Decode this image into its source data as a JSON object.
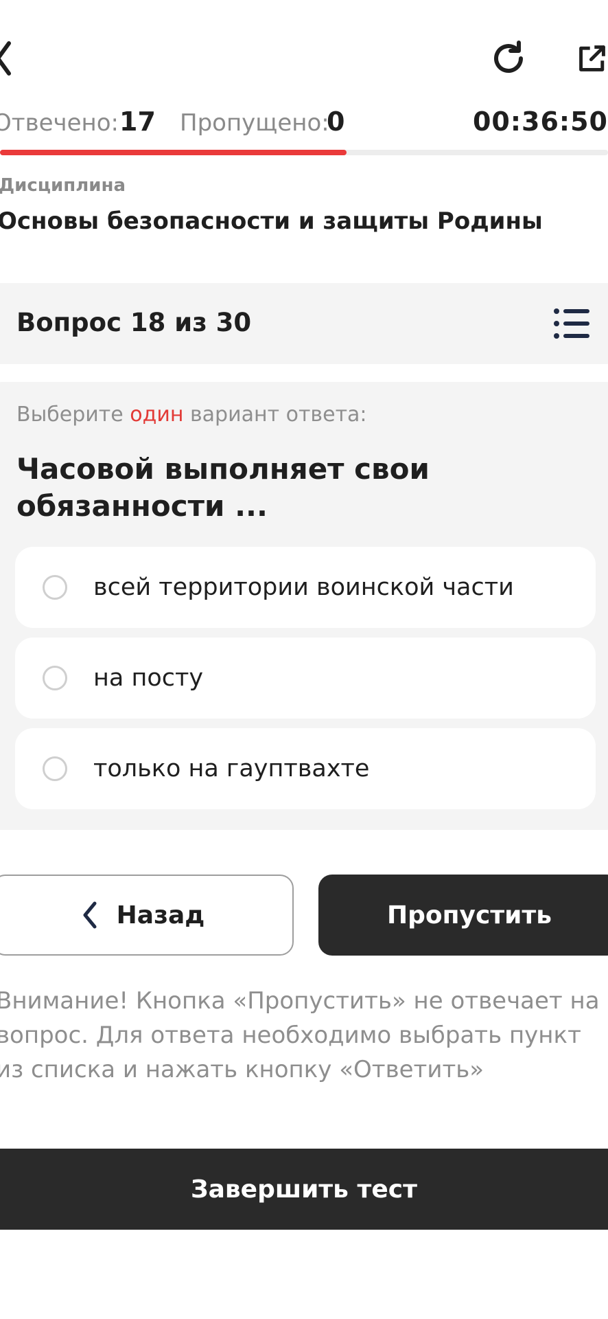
{
  "topbar": {
    "back_icon": "chevron-left-icon",
    "refresh_icon": "refresh-icon",
    "share_icon": "external-link-icon"
  },
  "stats": {
    "answered_label": "Отвечено:",
    "answered_value": "17",
    "skipped_label": "Пропущено:",
    "skipped_value": "0",
    "timer": "00:36:50",
    "progress_percent": 57
  },
  "discipline": {
    "label": "Дисциплина",
    "title": "Основы безопасности и защиты Родины"
  },
  "question_header": {
    "title": "Вопрос 18 из 30",
    "list_icon": "list-icon"
  },
  "question": {
    "hint_before": "Выберите ",
    "hint_accent": "один",
    "hint_after": " вариант ответа:",
    "text": "Часовой выполняет свои обязанности ...",
    "options": [
      "всей территории воинской части",
      "на посту",
      "только на гауптвахте"
    ]
  },
  "buttons": {
    "back": "Назад",
    "skip": "Пропустить",
    "finish": "Завершить тест"
  },
  "warning": "Внимание! Кнопка «Пропустить» не отвечает на вопрос. Для ответа необходимо выбрать пункт из списка и нажать кнопку «Ответить»",
  "colors": {
    "accent": "#ea3a3a",
    "dark_button": "#2a2a2a",
    "card_bg": "#f4f4f4",
    "muted_text": "#8e8e8e"
  }
}
